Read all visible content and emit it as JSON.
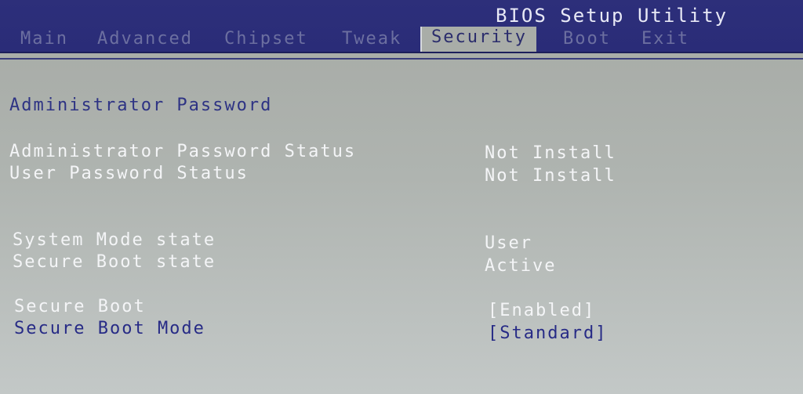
{
  "app": {
    "title": "BIOS Setup Utility"
  },
  "tabs": [
    {
      "label": "Main"
    },
    {
      "label": "Advanced"
    },
    {
      "label": "Chipset"
    },
    {
      "label": "Tweak"
    },
    {
      "label": "Security"
    },
    {
      "label": "Boot"
    },
    {
      "label": "Exit"
    }
  ],
  "active_tab": "Security",
  "security": {
    "section_title": "Administrator Password",
    "admin_password_status": {
      "label": "Administrator Password Status",
      "value": "Not Install"
    },
    "user_password_status": {
      "label": "User Password Status",
      "value": "Not Install"
    },
    "system_mode_state": {
      "label": "System Mode state",
      "value": "User"
    },
    "secure_boot_state": {
      "label": "Secure Boot state",
      "value": "Active"
    },
    "secure_boot": {
      "label": "Secure Boot",
      "value": "[Enabled]"
    },
    "secure_boot_mode": {
      "label": "Secure Boot Mode",
      "value": "[Standard]"
    }
  },
  "colors": {
    "header_bg": "#2d2f7a",
    "body_bg": "#afb4b0",
    "active_text": "#272b86",
    "static_text": "#f4f5f7",
    "inactive_tab": "#6c6fa0"
  }
}
